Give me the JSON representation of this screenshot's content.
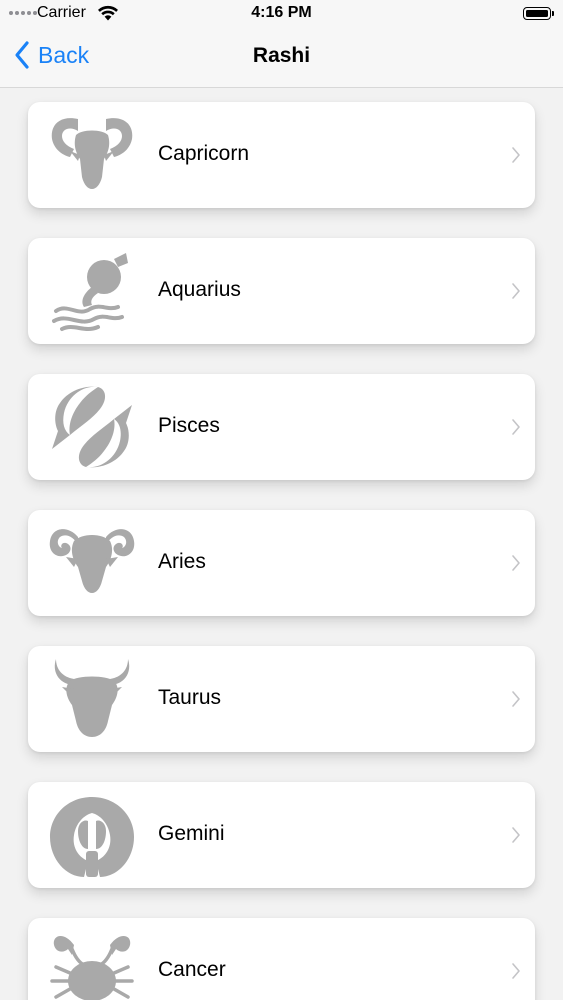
{
  "status_bar": {
    "carrier": "Carrier",
    "time": "4:16 PM"
  },
  "nav": {
    "back_label": "Back",
    "title": "Rashi"
  },
  "colors": {
    "accent": "#1a82f7",
    "icon_gray": "#a9a9a9",
    "chevron_gray": "#c4c4c7"
  },
  "rashi_list": [
    {
      "label": "Capricorn",
      "icon": "capricorn-icon"
    },
    {
      "label": "Aquarius",
      "icon": "aquarius-icon"
    },
    {
      "label": "Pisces",
      "icon": "pisces-icon"
    },
    {
      "label": "Aries",
      "icon": "aries-icon"
    },
    {
      "label": "Taurus",
      "icon": "taurus-icon"
    },
    {
      "label": "Gemini",
      "icon": "gemini-icon"
    },
    {
      "label": "Cancer",
      "icon": "cancer-icon"
    }
  ]
}
